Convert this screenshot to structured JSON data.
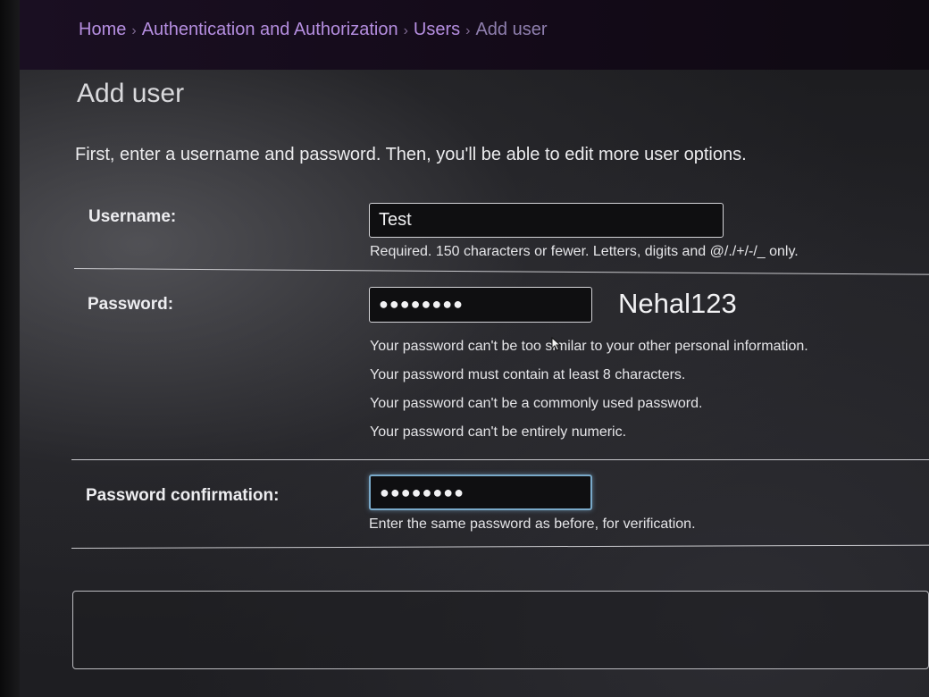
{
  "breadcrumb": {
    "home": "Home",
    "section": "Authentication and Authorization",
    "model": "Users",
    "current": "Add user",
    "separator": "›"
  },
  "page": {
    "title": "Add user",
    "intro": "First, enter a username and password. Then, you'll be able to edit more user options."
  },
  "form": {
    "username": {
      "label": "Username:",
      "value": "Test",
      "help": "Required. 150 characters or fewer. Letters, digits and @/./+/-/_ only."
    },
    "password": {
      "label": "Password:",
      "masked_value": "●●●●●●●●",
      "help": [
        "Your password can't be too similar to your other personal information.",
        "Your password must contain at least 8 characters.",
        "Your password can't be a commonly used password.",
        "Your password can't be entirely numeric."
      ],
      "annotation": "Nehal123"
    },
    "password_confirmation": {
      "label": "Password confirmation:",
      "masked_value": "●●●●●●●●",
      "help": "Enter the same password as before, for verification."
    }
  },
  "colors": {
    "link": "#b58ee0",
    "header_bg": "#1a0f22",
    "focus_border": "#79a9c9"
  },
  "icons": {
    "pointer": "mouse-pointer-icon"
  }
}
